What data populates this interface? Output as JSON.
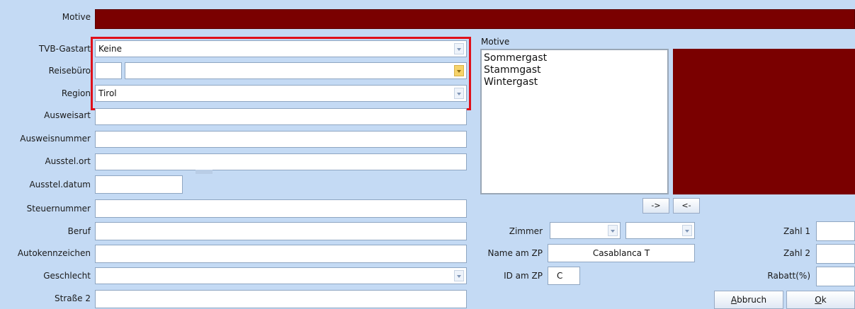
{
  "top": {
    "motive_label": "Motive"
  },
  "form": {
    "tvb_gastart": {
      "label": "TVB-Gastart",
      "value": "Keine"
    },
    "reisebuero": {
      "label": "Reisebüro",
      "value": ""
    },
    "region": {
      "label": "Region",
      "value": "Tirol"
    },
    "ausweisart": {
      "label": "Ausweisart",
      "value": ""
    },
    "ausweisnummer": {
      "label": "Ausweisnummer",
      "value": ""
    },
    "ausstel_ort": {
      "label": "Ausstel.ort",
      "value": ""
    },
    "ausstel_datum": {
      "label": "Ausstel.datum",
      "value": ""
    },
    "steuernummer": {
      "label": "Steuernummer",
      "value": ""
    },
    "beruf": {
      "label": "Beruf",
      "value": ""
    },
    "autokennzeichen": {
      "label": "Autokennzeichen",
      "value": ""
    },
    "geschlecht": {
      "label": "Geschlecht",
      "value": ""
    },
    "strasse2": {
      "label": "Straße 2",
      "value": ""
    }
  },
  "motive_panel": {
    "label": "Motive",
    "items": [
      "Sommergast",
      "Stammgast",
      "Wintergast"
    ],
    "add_button": "->",
    "remove_button": "<-"
  },
  "right": {
    "zimmer_label": "Zimmer",
    "name_am_zp_label": "Name am ZP",
    "name_am_zp_value": "Casablanca T",
    "id_am_zp_label": "ID am ZP",
    "id_am_zp_value": "C",
    "zahl1_label": "Zahl 1",
    "zahl2_label": "Zahl 2",
    "rabatt_label": "Rabatt(%)"
  },
  "buttons": {
    "abbruch_first": "A",
    "abbruch_rest": "bbruch",
    "ok_first": "O",
    "ok_rest": "k"
  },
  "colors": {
    "maroon": "#7a0000",
    "highlight": "#e0101a",
    "background": "#c4daf4"
  }
}
